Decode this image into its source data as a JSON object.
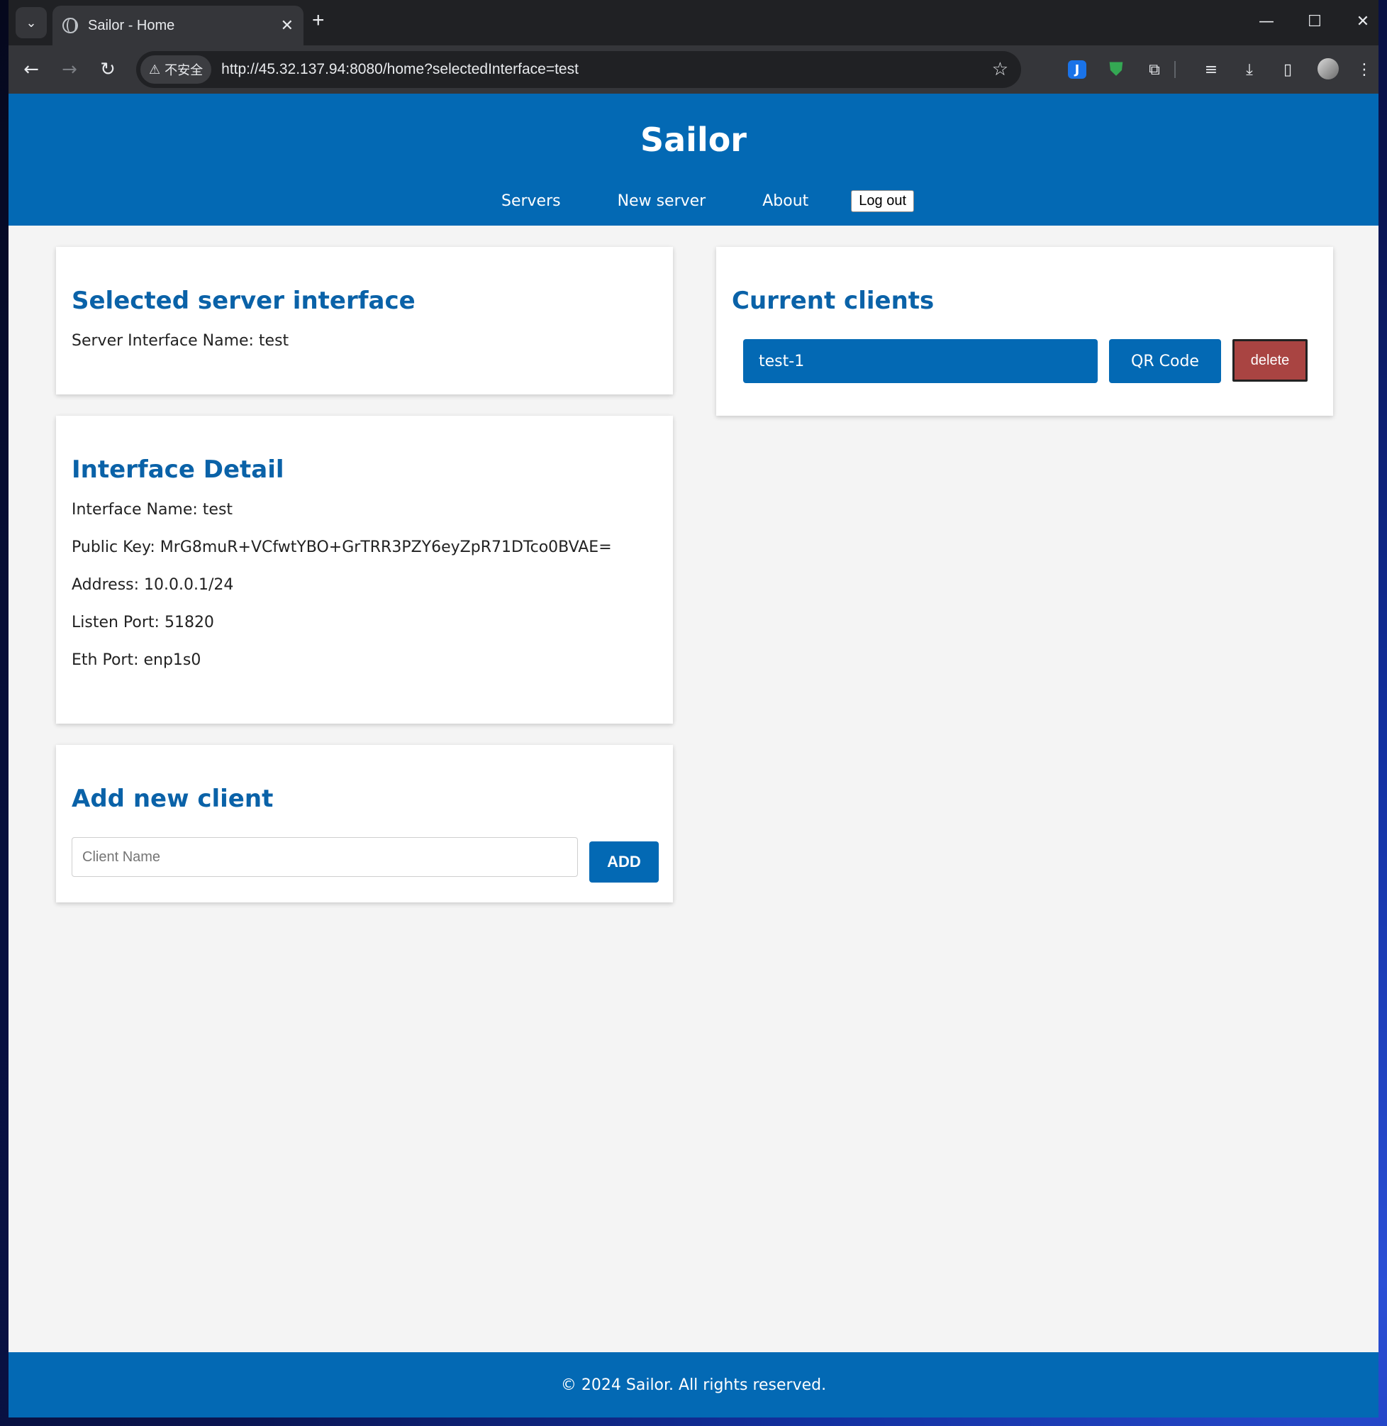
{
  "browser": {
    "tab_title": "Sailor - Home",
    "security_label": "不安全",
    "url": "http://45.32.137.94:8080/home?selectedInterface=test"
  },
  "header": {
    "title": "Sailor",
    "nav": [
      "Servers",
      "New server",
      "About"
    ],
    "logout_label": "Log out"
  },
  "selected_interface": {
    "heading": "Selected server interface",
    "name_line": "Server Interface Name: test"
  },
  "interface_detail": {
    "heading": "Interface Detail",
    "lines": [
      "Interface Name: test",
      "Public Key: MrG8muR+VCfwtYBO+GrTRR3PZY6eyZpR71DTco0BVAE=",
      "Address: 10.0.0.1/24",
      "Listen Port: 51820",
      "Eth Port: enp1s0"
    ]
  },
  "add_client": {
    "heading": "Add new client",
    "placeholder": "Client Name",
    "add_label": "ADD"
  },
  "current_clients": {
    "heading": "Current clients",
    "clients": [
      {
        "name": "test-1",
        "qr_label": "QR Code",
        "delete_label": "delete"
      }
    ]
  },
  "footer": {
    "text": "© 2024 Sailor. All rights reserved."
  },
  "colors": {
    "brand_blue": "#0369b4",
    "heading_blue": "#0a62a8",
    "delete_red": "#a94442"
  }
}
